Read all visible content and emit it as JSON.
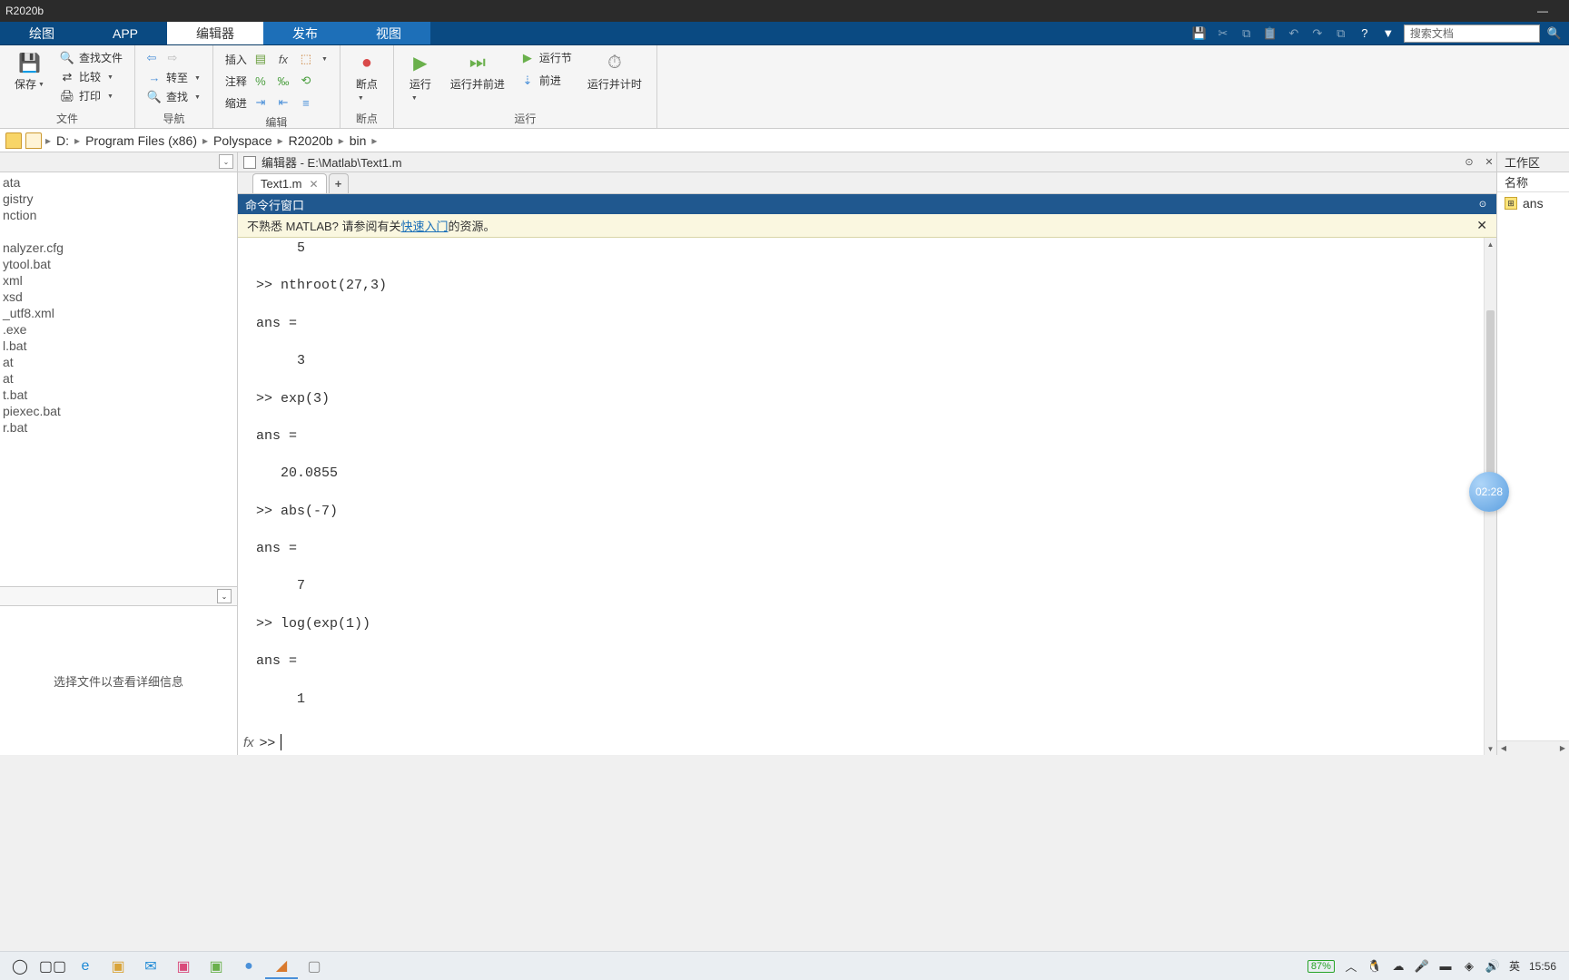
{
  "titlebar": {
    "title": "R2020b",
    "minimize": "—"
  },
  "ribbonTabs": {
    "plot": "绘图",
    "app": "APP",
    "editor": "编辑器",
    "publish": "发布",
    "view": "视图",
    "searchPlaceholder": "搜索文档"
  },
  "ribbon": {
    "file": {
      "save": "保存",
      "find": "查找文件",
      "compare": "比较",
      "print": "打印",
      "title": "文件"
    },
    "nav": {
      "goto": "转至",
      "search": "查找",
      "title": "导航"
    },
    "edit": {
      "insert": "插入",
      "comment": "注释",
      "indent": "缩进",
      "title": "编辑"
    },
    "break": {
      "breakpoints": "断点",
      "title": "断点"
    },
    "run": {
      "run": "运行",
      "runAdvance": "运行并前进",
      "runSection": "运行节",
      "advance": "前进",
      "runTime": "运行并计时",
      "title": "运行"
    }
  },
  "breadcrumb": {
    "drive": "D:",
    "p1": "Program Files (x86)",
    "p2": "Polyspace",
    "p3": "R2020b",
    "p4": "bin"
  },
  "side": {
    "files": [
      "ata",
      "gistry",
      "nction",
      "",
      "nalyzer.cfg",
      "ytool.bat",
      "xml",
      "xsd",
      "_utf8.xml",
      ".exe",
      "l.bat",
      "at",
      "at",
      "t.bat",
      "piexec.bat",
      "r.bat"
    ],
    "detail": "选择文件以查看详细信息"
  },
  "editor": {
    "path": "编辑器 - E:\\Matlab\\Text1.m",
    "tab": "Text1.m"
  },
  "cmd": {
    "title": "命令行窗口",
    "bannerPre": "不熟悉 MATLAB? 请参阅有关",
    "bannerLink": "快速入门",
    "bannerPost": "的资源。",
    "body": "     5\n\n>> nthroot(27,3)\n\nans =\n\n     3\n\n>> exp(3)\n\nans =\n\n   20.0855\n\n>> abs(-7)\n\nans =\n\n     7\n\n>> log(exp(1))\n\nans =\n\n     1",
    "prompt": ">>",
    "fx": "fx"
  },
  "workspace": {
    "title": "工作区",
    "nameCol": "名称",
    "var": "ans"
  },
  "clock": "02:28",
  "tray": {
    "battery": "87%",
    "ime": "英",
    "time": "15:56"
  }
}
